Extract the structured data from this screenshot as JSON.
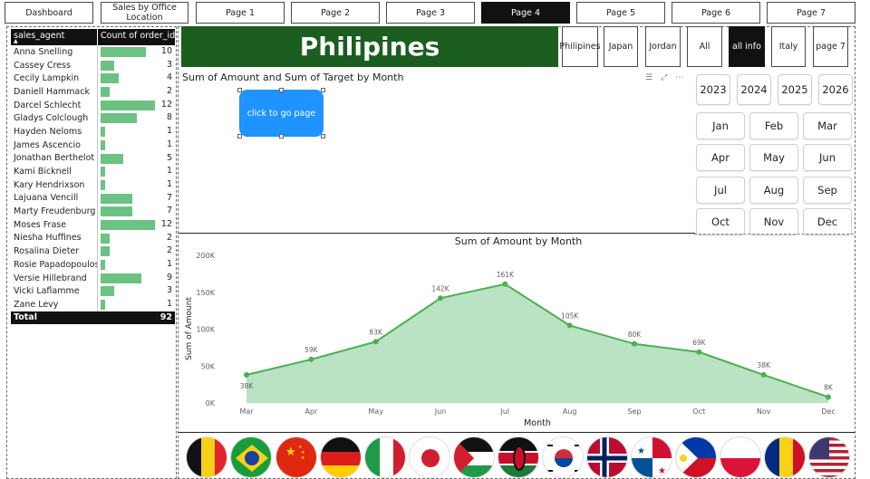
{
  "nav": {
    "buttons": [
      "Dashboard",
      "Sales by Office Location",
      "Page 1",
      "Page 2",
      "Page 3",
      "Page 4",
      "Page 5",
      "Page 6",
      "Page 7"
    ],
    "active": "Page 4"
  },
  "table": {
    "col1": "sales_agent",
    "col2": "Count of order_id",
    "rows": [
      {
        "name": "Anna Snelling",
        "count": 10
      },
      {
        "name": "Cassey Cress",
        "count": 3
      },
      {
        "name": "Cecily Lampkin",
        "count": 4
      },
      {
        "name": "Daniell Hammack",
        "count": 2
      },
      {
        "name": "Darcel Schlecht",
        "count": 12
      },
      {
        "name": "Gladys Colclough",
        "count": 8
      },
      {
        "name": "Hayden Neloms",
        "count": 1
      },
      {
        "name": "James Ascencio",
        "count": 1
      },
      {
        "name": "Jonathan Berthelot",
        "count": 5
      },
      {
        "name": "Kami Bicknell",
        "count": 1
      },
      {
        "name": "Kary Hendrixson",
        "count": 1
      },
      {
        "name": "Lajuana Vencill",
        "count": 7
      },
      {
        "name": "Marty Freudenburg",
        "count": 7
      },
      {
        "name": "Moses Frase",
        "count": 12
      },
      {
        "name": "Niesha Huffines",
        "count": 2
      },
      {
        "name": "Rosalina Dieter",
        "count": 2
      },
      {
        "name": "Rosie Papadopoulos",
        "count": 1
      },
      {
        "name": "Versie Hillebrand",
        "count": 9
      },
      {
        "name": "Vicki Laflamme",
        "count": 3
      },
      {
        "name": "Zane Levy",
        "count": 1
      }
    ],
    "total_label": "Total",
    "total_value": 92,
    "bar_max": 12,
    "bar_color": "#6cc283"
  },
  "header": {
    "country_title": "Philipines",
    "title_bg": "#1b5e20",
    "country_buttons": [
      "Philipines",
      "Japan",
      "Jordan",
      "All",
      "all info",
      "Italy",
      "page 7"
    ],
    "active_country": "all info"
  },
  "visual": {
    "title": "Sum of Amount and Sum of Target by Month",
    "go_button": "click to go page",
    "icons": [
      "filter-icon",
      "focus-mode-icon",
      "more-options-icon"
    ]
  },
  "slicers": {
    "years": [
      "2023",
      "2024",
      "2025",
      "2026"
    ],
    "months": [
      "Jan",
      "Feb",
      "Mar",
      "Apr",
      "May",
      "Jun",
      "Jul",
      "Aug",
      "Sep",
      "Oct",
      "Nov",
      "Dec"
    ]
  },
  "chart_data": {
    "type": "area",
    "title": "Sum of Amount by Month",
    "xlabel": "Month",
    "ylabel": "Sum of Amount",
    "categories": [
      "Mar",
      "Apr",
      "May",
      "Jun",
      "Jul",
      "Aug",
      "Sep",
      "Oct",
      "Nov",
      "Dec"
    ],
    "values": [
      38000,
      59000,
      83000,
      142000,
      161000,
      105000,
      80000,
      69000,
      38000,
      8000
    ],
    "data_labels": [
      "38K",
      "59K",
      "83K",
      "142K",
      "161K",
      "105K",
      "80K",
      "69K",
      "38K",
      "8K"
    ],
    "yticks": [
      "0K",
      "50K",
      "100K",
      "150K",
      "200K"
    ],
    "ylim": [
      0,
      200000
    ],
    "line_color": "#4caf50",
    "fill_color": "#b9e3c2",
    "grid": false,
    "legend": "none"
  },
  "flags": [
    "Belgium",
    "Brazil",
    "China",
    "Germany",
    "Italy",
    "Japan",
    "Jordan",
    "Kenya",
    "South Korea",
    "Norway",
    "Panama",
    "Philippines",
    "Poland",
    "Romania",
    "United States"
  ]
}
